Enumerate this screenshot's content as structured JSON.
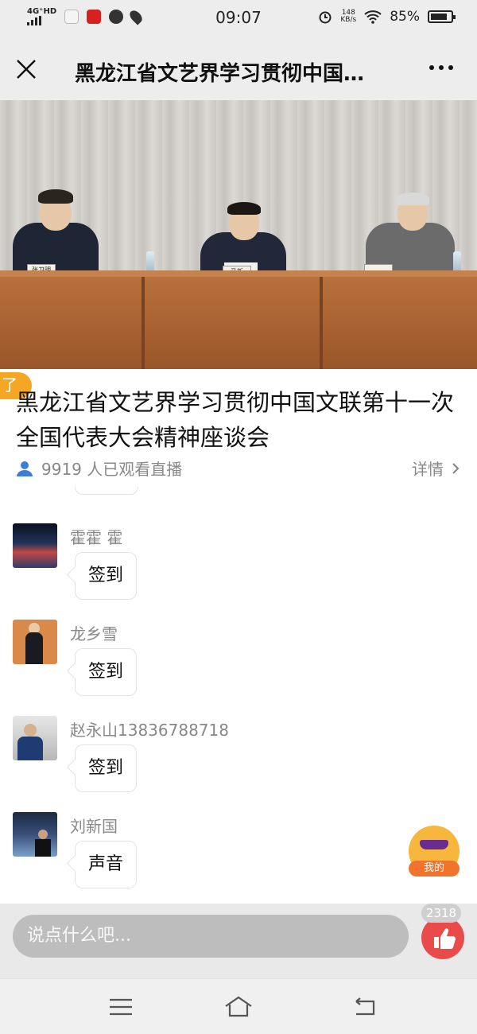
{
  "status_bar": {
    "network": "4G⁺HD",
    "time": "09:07",
    "net_speed_value": "148",
    "net_speed_unit": "KB/s",
    "battery": "85%",
    "battery_level": 0.85
  },
  "nav": {
    "title": "黑龙江省文艺界学习贯彻中国…"
  },
  "video": {
    "nameplates": [
      "张卫明",
      "马新",
      ""
    ]
  },
  "live": {
    "badge": "了",
    "title": "黑龙江省文艺界学习贯彻中国文联第十一次全国代表大会精神座谈会",
    "viewers": "9919 人已观看直播",
    "details": "详情"
  },
  "comments": [
    {
      "name": "霍霍 霍",
      "text": "签到"
    },
    {
      "name": "龙乡雪",
      "text": "签到"
    },
    {
      "name": "赵永山13836788718",
      "text": "签到"
    },
    {
      "name": "刘新国",
      "text": "声音"
    }
  ],
  "mine": {
    "label": "我的"
  },
  "input": {
    "placeholder": "说点什么吧..."
  },
  "like": {
    "count": "2318"
  },
  "colors": {
    "accent": "#e94a4a",
    "badge": "#f5a623"
  }
}
